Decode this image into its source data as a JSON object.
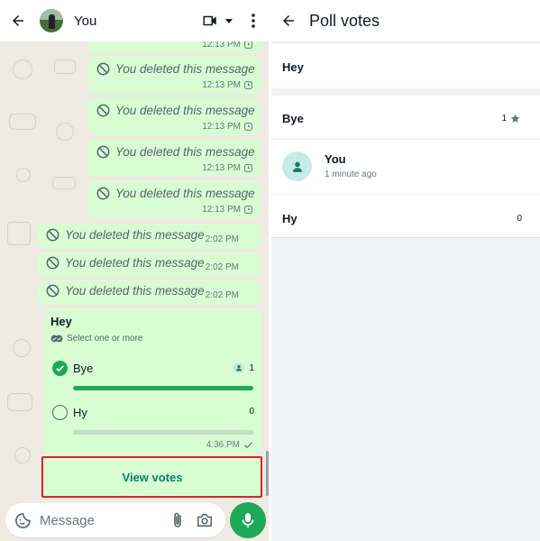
{
  "chat": {
    "contact_name": "You",
    "deleted_text": "You deleted this message",
    "messages_top": [
      {
        "time": "12:13 PM"
      },
      {
        "time": "12:13 PM"
      },
      {
        "time": "12:13 PM"
      },
      {
        "time": "12:13 PM"
      },
      {
        "time": "12:13 PM"
      }
    ],
    "messages_mid": [
      {
        "time": "2:02 PM"
      },
      {
        "time": "2:02 PM"
      },
      {
        "time": "2:02 PM"
      }
    ],
    "poll": {
      "question": "Hey",
      "subtitle": "Select one or more",
      "options": [
        {
          "label": "Bye",
          "count": "1",
          "selected": true,
          "fill": 1.0
        },
        {
          "label": "Hy",
          "count": "0",
          "selected": false,
          "fill": 0.0
        }
      ],
      "time": "4:36 PM"
    },
    "view_votes_label": "View votes",
    "composer_placeholder": "Message"
  },
  "poll_votes": {
    "title": "Poll votes",
    "question": "Hey",
    "options": [
      {
        "label": "Bye",
        "count": "1",
        "starred": true,
        "voters": [
          {
            "name": "You",
            "time": "1 minute ago"
          }
        ]
      },
      {
        "label": "Hy",
        "count": "0",
        "starred": false,
        "voters": []
      }
    ]
  },
  "colors": {
    "accent_green": "#1fa855",
    "bubble_green": "#d9fdd3",
    "chat_wallpaper": "#efeae2",
    "highlight_red": "#d9232a",
    "link_teal": "#00846b"
  },
  "icons": [
    "back-arrow-icon",
    "video-call-icon",
    "dropdown-icon",
    "more-vert-icon",
    "deleted-icon",
    "pending-clock-icon",
    "checkmark-icon",
    "sticker-icon",
    "attach-icon",
    "camera-icon",
    "mic-icon",
    "person-icon",
    "star-icon"
  ]
}
